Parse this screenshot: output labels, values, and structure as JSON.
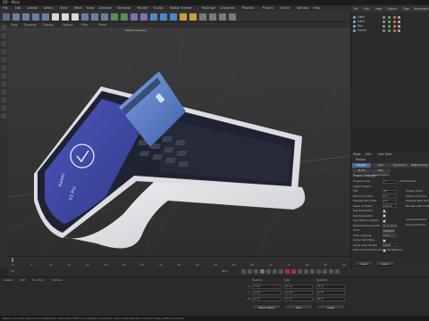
{
  "app": {
    "title": "4D - Main",
    "colors": {
      "accent": "#4a6a9a",
      "viewport_bg": "#3a3a3a",
      "panel_bg": "#2b2b2b",
      "terminal_screen": "#3f4aa3",
      "terminal_body": "#e6e6ea",
      "card": "#5a7dc4"
    }
  },
  "menubar": {
    "items": [
      "File",
      "Edit",
      "Create",
      "Select",
      "Tools",
      "Mesh",
      "Snap",
      "Animate",
      "Simulate",
      "Render",
      "Sculpt",
      "Motion Tracker",
      "MoGraph",
      "Character",
      "Pipeline",
      "Plugins",
      "Script",
      "Window",
      "Help"
    ]
  },
  "viewport": {
    "menu": [
      "View",
      "Cameras",
      "Display",
      "Options",
      "Filter",
      "Panel"
    ],
    "label": "Default Camera"
  },
  "terminal": {
    "brand_name": "sunmi",
    "product_label": "V2 Pro"
  },
  "object_manager": {
    "tabs": [
      "File",
      "Edit",
      "View",
      "Objects",
      "Tags",
      "Bookmarks"
    ],
    "objects": [
      {
        "name": "Light"
      },
      {
        "name": "Card"
      },
      {
        "name": "Sky"
      },
      {
        "name": "Sunmi"
      }
    ]
  },
  "attributes": {
    "tabs": [
      "Mode",
      "Edit",
      "User Data"
    ],
    "section_tabs": [
      "Project Settings",
      "Info",
      "Dynamics",
      "Referencing"
    ],
    "section_tabs2": [
      "To Do",
      "Key Interpolation"
    ],
    "heading": "Project",
    "subheading": "Project Settings",
    "rows_left": [
      {
        "label": "Project Scale",
        "value": "1",
        "unit": "Centimeters"
      },
      {
        "label": "Scale Project..."
      },
      {
        "label": "FPS",
        "value": "30"
      },
      {
        "label": "Minimum Time",
        "value": "0 F"
      },
      {
        "label": "Preview Min Time",
        "value": "0 F"
      },
      {
        "label": "Level of Detail",
        "value": "100 %"
      },
      {
        "label": "Use Animation"
      },
      {
        "label": "Use Expression"
      },
      {
        "label": "Use Motion System"
      },
      {
        "label": "Default Object Color",
        "value": "Gray-Blue"
      },
      {
        "label": "Color"
      },
      {
        "label": "View Clipping",
        "value": "Medium"
      },
      {
        "label": "Linear Workflow"
      },
      {
        "label": "Input Color Profile",
        "value": "sRGB"
      },
      {
        "label": "Use Color Channel for Node Material"
      }
    ],
    "rows_right": [
      {
        "label": "Project Time"
      },
      {
        "label": "Maximum Time"
      },
      {
        "label": "Preview Max Time"
      },
      {
        "label": "Render LOD in Editor"
      },
      {
        "label": "Use Generators"
      },
      {
        "label": "Use Deformers"
      }
    ],
    "buttons": [
      "Load Preset...",
      "Save Preset..."
    ]
  },
  "timeline": {
    "ticks": [
      "0",
      "5",
      "10",
      "15",
      "20",
      "25",
      "30",
      "35",
      "40",
      "45",
      "50",
      "55",
      "60",
      "65",
      "70",
      "75",
      "80",
      "85",
      "90"
    ],
    "current_frame": "0 F",
    "end_frame": "90 F"
  },
  "bottom": {
    "left_labels": [
      "Create",
      "Edit",
      "Function",
      "Texture"
    ],
    "coord_headers": [
      "Position",
      "Size",
      "Rotation"
    ],
    "coord_rows": [
      {
        "axis": "X",
        "pos": "0 cm",
        "size": "0 cm",
        "rot": "H 0°"
      },
      {
        "axis": "Y",
        "pos": "0 cm",
        "size": "0 cm",
        "rot": "P 0°"
      },
      {
        "axis": "Z",
        "pos": "0 cm",
        "size": "0 cm",
        "rot": "B 0°"
      }
    ],
    "coord_mode": "Object (Rel)",
    "size_mode": "Size",
    "apply_label": "Apply"
  },
  "status": {
    "text": "Move: Click and drag to move elements. Hold down SHIFT to quantize movement / add to the selection in point mode, CTRL to remove."
  }
}
